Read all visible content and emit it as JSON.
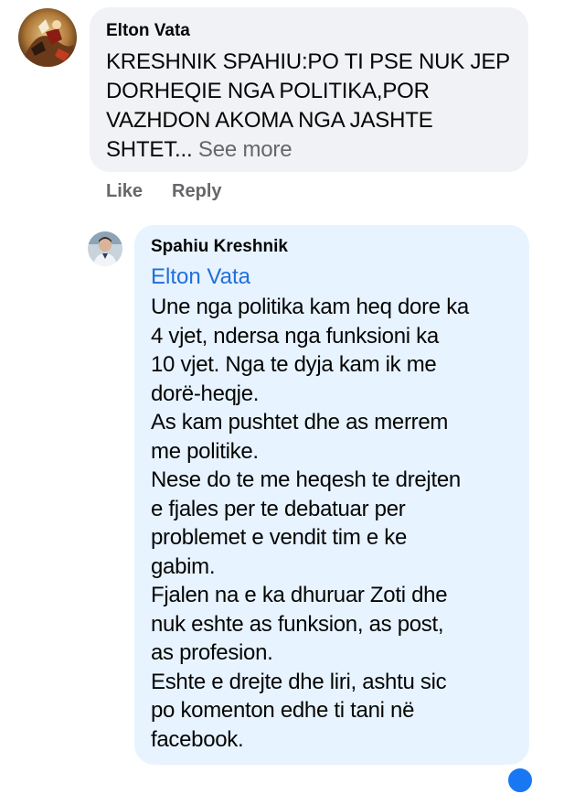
{
  "comment1": {
    "author": "Elton Vata",
    "text": "KRESHNIK SPAHIU:PO TI PSE NUK JEP DORHEQIE NGA POLITIKA,POR VAZHDON AKOMA NGA JASHTE SHTET...",
    "see_more": "See more",
    "like_label": "Like",
    "reply_label": "Reply"
  },
  "reply": {
    "author": "Spahiu Kreshnik",
    "mention": "Elton Vata",
    "lines": [
      "Une nga politika kam heq dore ka",
      "4 vjet, ndersa nga funksioni ka",
      "10 vjet. Nga te dyja kam ik me",
      "dorë-heqje.",
      "As kam pushtet dhe as merrem",
      "me politike.",
      "Nese do te me heqesh te drejten",
      "e fjales per te debatuar per",
      "problemet e vendit tim e ke",
      "gabim.",
      "Fjalen na e ka dhuruar Zoti dhe",
      "nuk eshte as funksion, as post,",
      "as profesion.",
      "Eshte e drejte dhe liri, ashtu sic",
      "po komenton edhe ti tani në",
      "facebook."
    ]
  },
  "colors": {
    "bubble_gray": "#f0f2f5",
    "bubble_blue": "#e7f3ff",
    "mention_blue": "#216fdb",
    "meta_gray": "#65676b"
  }
}
